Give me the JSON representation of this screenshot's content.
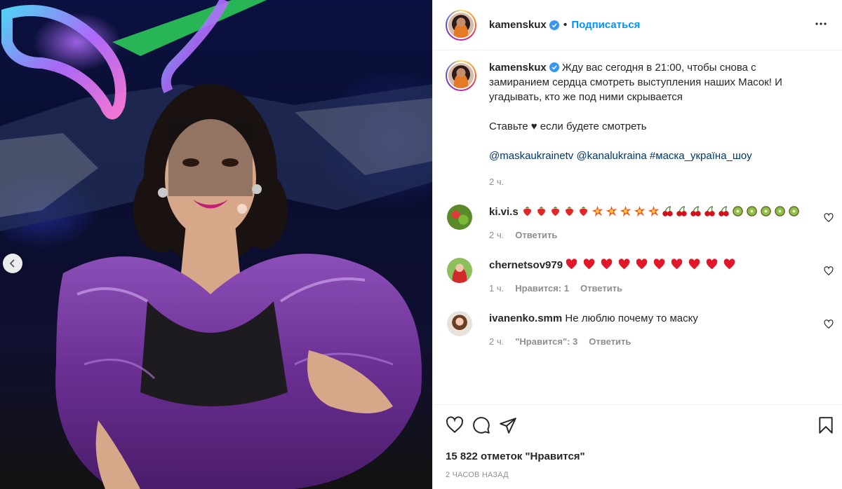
{
  "post": {
    "author": "kamenskux",
    "follow_label": "Подписаться",
    "caption": {
      "line1": "Жду вас сегодня в 21:00, чтобы снова с замиранием сердца смотреть выступления наших Масок! И угадывать, кто же под ними скрывается",
      "line2_before": "Ставьте",
      "line2_after": "если будете смотреть",
      "tag1": "@maskaukrainetv",
      "tag2": "@kanalukraina",
      "tag3": "#маска_україна_шоу",
      "time": "2 ч."
    }
  },
  "comments": [
    {
      "user": "ki.vi.s",
      "time": "2 ч.",
      "reply_label": "Ответить",
      "likes_label": ""
    },
    {
      "user": "chernetsov979",
      "time": "1 ч.",
      "likes_label": "Нравится: 1",
      "reply_label": "Ответить"
    },
    {
      "user": "ivanenko.smm",
      "text": "Не люблю почему то маску",
      "time": "2 ч.",
      "likes_label": "\"Нравится\": 3",
      "reply_label": "Ответить"
    }
  ],
  "footer": {
    "likes_text": "15 822 отметок \"Нравится\"",
    "posted_ago": "2 часов назад"
  },
  "colors": {
    "link": "#0095f6",
    "tag": "#00376b",
    "muted": "#8e8e8e",
    "verified": "#3897f0"
  },
  "icons": [
    "more-options-icon",
    "heart-icon",
    "comment-icon",
    "share-icon",
    "bookmark-icon",
    "chevron-left-icon",
    "verified-badge-icon"
  ]
}
